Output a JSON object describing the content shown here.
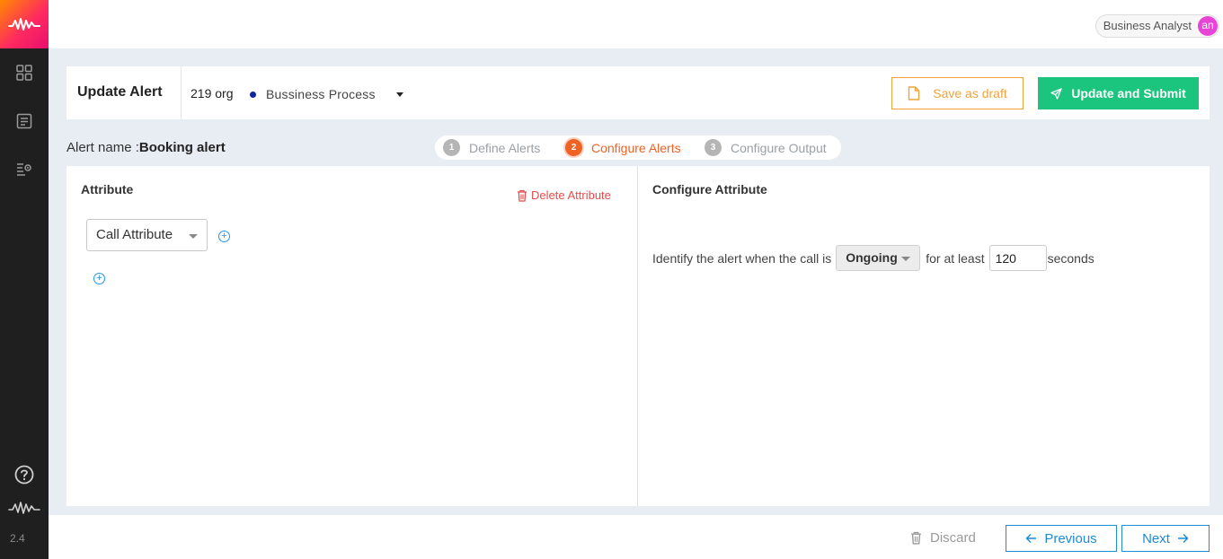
{
  "app": {
    "version": "2.4"
  },
  "sidebar": {
    "items": [
      {
        "icon": "dashboard-grid-icon"
      },
      {
        "icon": "document-list-icon"
      },
      {
        "icon": "settings-list-icon"
      }
    ],
    "bottom": {
      "help_icon": "help-circle-icon",
      "brand_icon": "waveform-icon"
    }
  },
  "topbar": {
    "user_role": "Business Analyst",
    "avatar_initials": "an"
  },
  "header": {
    "title": "Update Alert",
    "org": "219 org",
    "process": "Bussiness Process",
    "save_draft_label": "Save as draft",
    "submit_label": "Update and Submit"
  },
  "alert": {
    "name_label": "Alert name :",
    "name_value": "Booking alert"
  },
  "steps": [
    {
      "num": "1",
      "label": "Define Alerts",
      "state": "done"
    },
    {
      "num": "2",
      "label": "Configure Alerts",
      "state": "active"
    },
    {
      "num": "3",
      "label": "Configure Output",
      "state": "pending"
    }
  ],
  "left_panel": {
    "title": "Attribute",
    "delete_label": "Delete Attribute",
    "select_value": "Call Attribute"
  },
  "right_panel": {
    "title": "Configure Attribute",
    "sentence_prefix": "Identify the alert when the call is",
    "state_value": "Ongoing",
    "sentence_middle": "for at least",
    "seconds_value": "120",
    "sentence_suffix": "seconds"
  },
  "footer": {
    "discard_label": "Discard",
    "previous_label": "Previous",
    "next_label": "Next"
  },
  "colors": {
    "accent_orange": "#f06224",
    "draft_orange": "#f0a33a",
    "submit_green": "#1bc57e",
    "link_blue": "#1f8bd6",
    "delete_red": "#e84c4c",
    "sidebar_dark": "#1f1f1f"
  }
}
